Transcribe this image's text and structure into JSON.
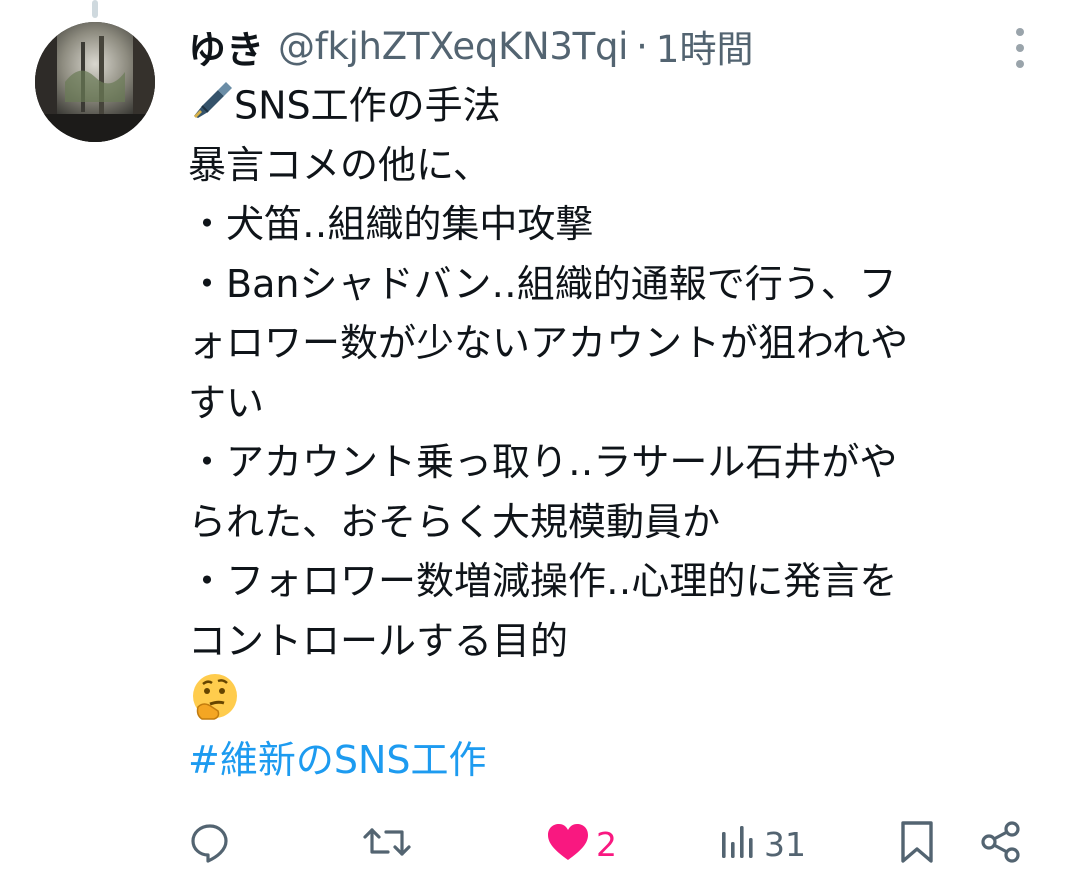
{
  "post": {
    "display_name": "ゆき",
    "handle": "@fkjhZTXeqKN3Tqi",
    "separator": "·",
    "time": "1時間",
    "lines": [
      "SNS工作の手法",
      "暴言コメの他に、",
      "・犬笛‥組織的集中攻撃",
      "・Banシャドバン‥組織的通報で行う、フ",
      "ォロワー数が少ないアカウントが狙われや",
      "すい",
      "・アカウント乗っ取り‥ラサール石井がや",
      "られた、おそらく大規模動員か",
      "・フォロワー数増減操作‥心理的に発言を",
      "コントロールする目的"
    ],
    "hashtag": "#維新のSNS工作",
    "leading_emoji": "fountain-pen-emoji",
    "trailing_emoji": "thinking-face-emoji"
  },
  "actions": {
    "reply_count": "",
    "repost_count": "",
    "like_count": "2",
    "view_count": "31"
  },
  "colors": {
    "text": "#0f1419",
    "secondary": "#536471",
    "link": "#1d9bf0",
    "like": "#f91880"
  }
}
